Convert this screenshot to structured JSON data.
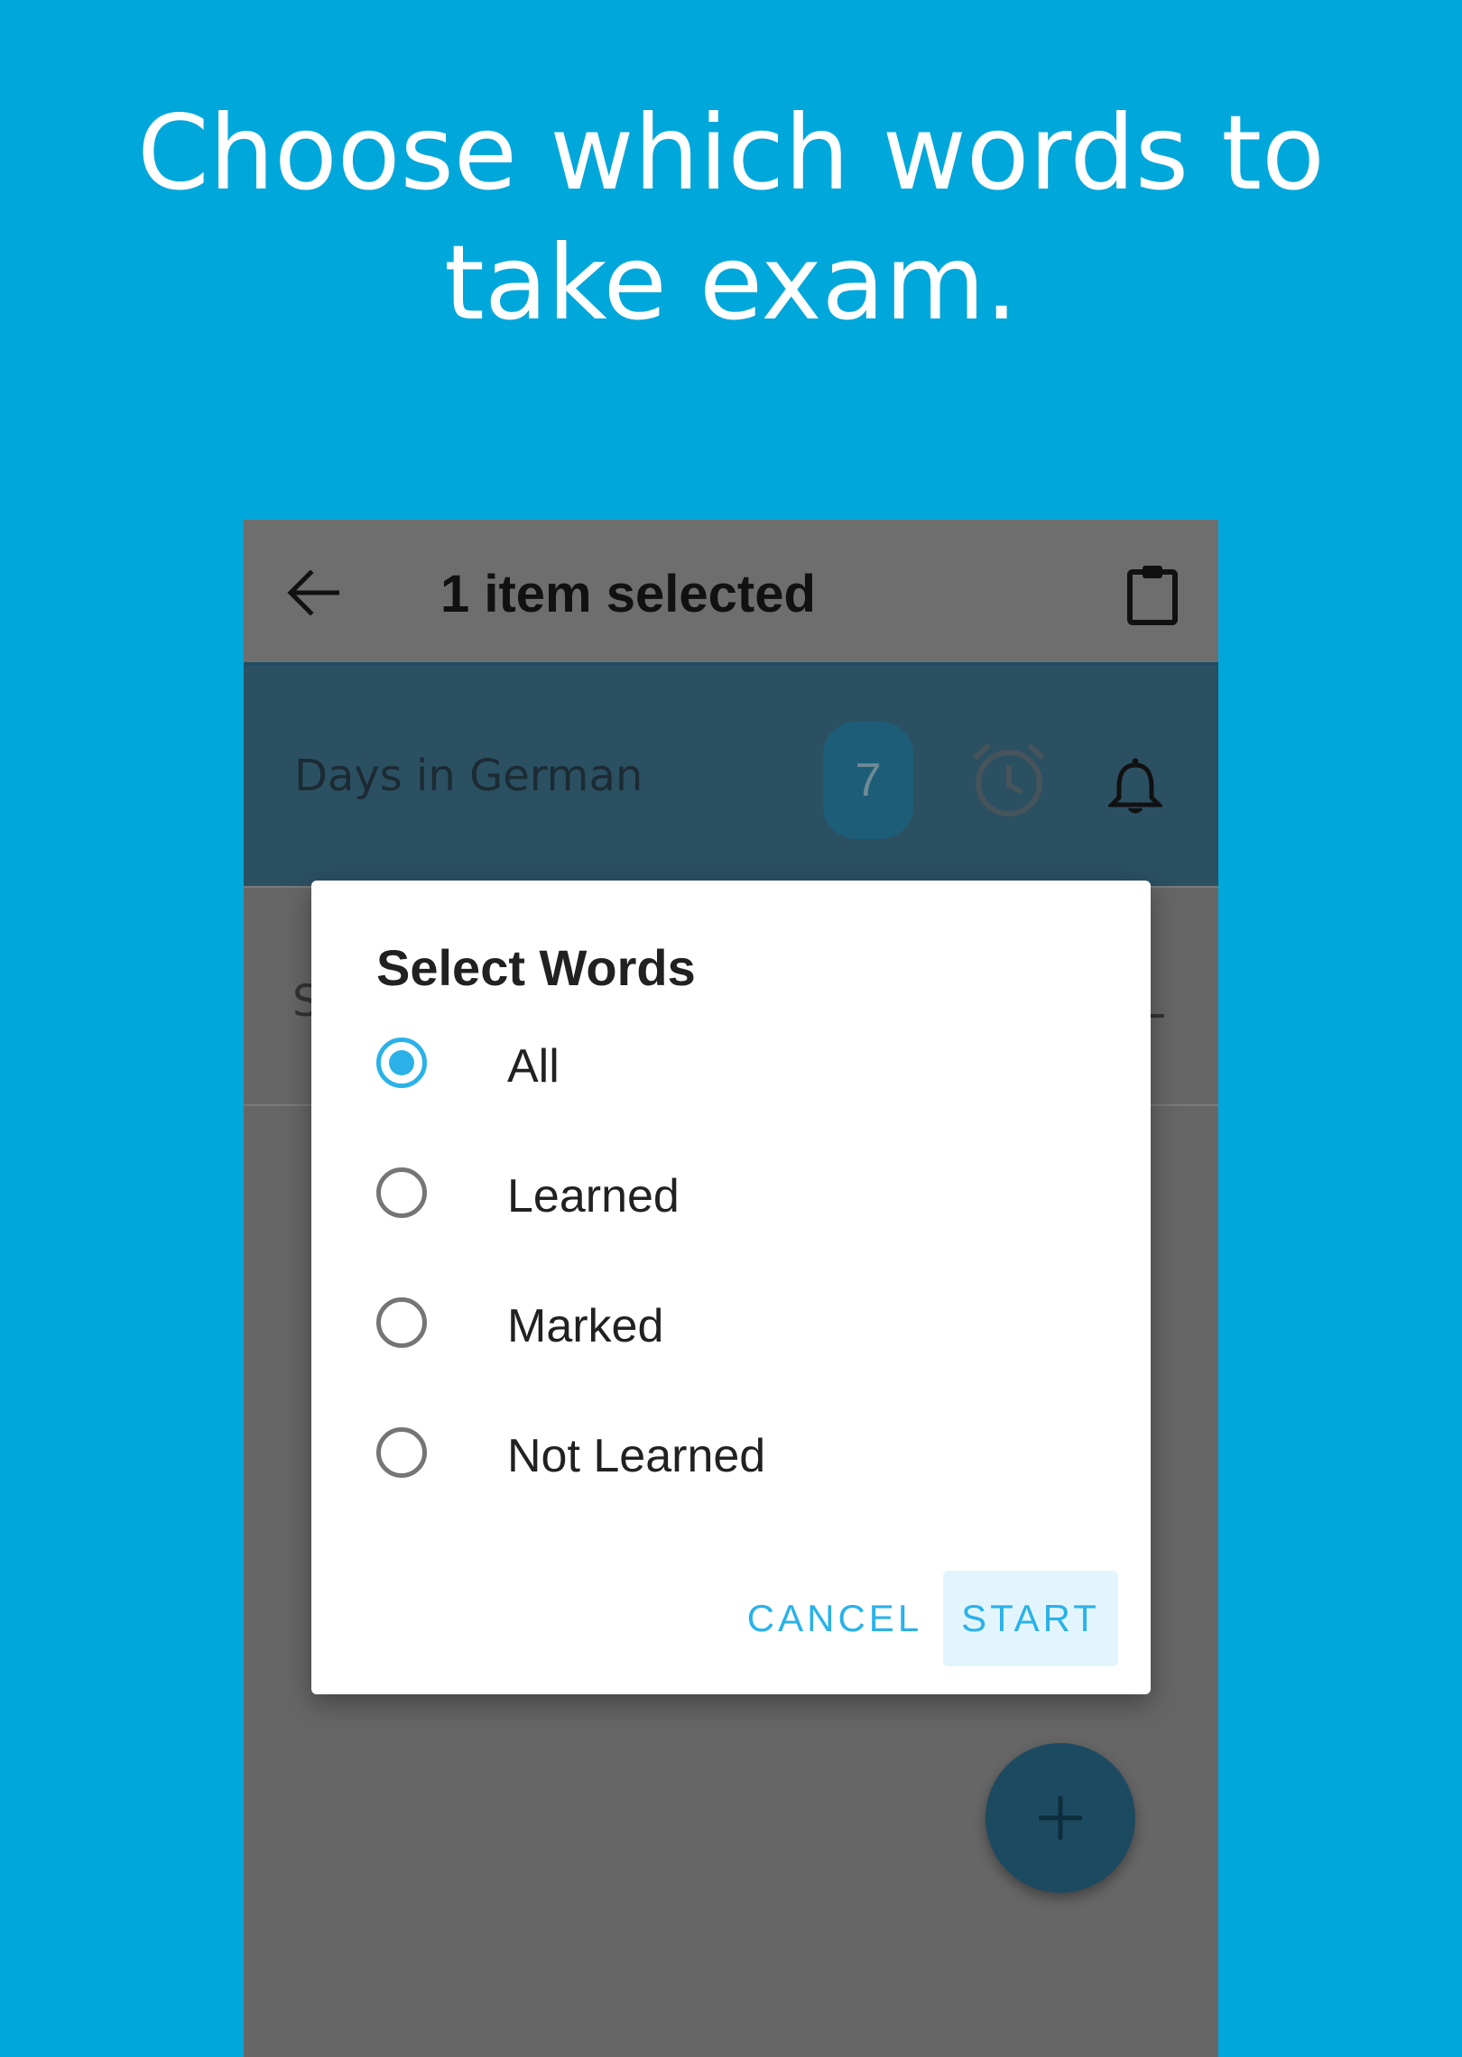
{
  "headline": {
    "line1": "Choose which words to",
    "line2": "take exam."
  },
  "appbar": {
    "title": "1 item selected",
    "back_icon": "arrow-back-icon",
    "clipboard_icon": "clipboard-icon"
  },
  "list": {
    "selected_row": {
      "title": "Days in German",
      "count": "7",
      "alarm_icon": "alarm-clock-icon",
      "bell_icon": "bell-icon"
    },
    "second_row": {
      "initial": "S"
    }
  },
  "dialog": {
    "title": "Select Words",
    "options": [
      {
        "label": "All",
        "selected": true
      },
      {
        "label": "Learned",
        "selected": false
      },
      {
        "label": "Marked",
        "selected": false
      },
      {
        "label": "Not Learned",
        "selected": false
      }
    ],
    "cancel_label": "CANCEL",
    "start_label": "START"
  },
  "colors": {
    "background": "#00a7da",
    "accent": "#2ab2e8",
    "selected_row": "#2b5062",
    "fab": "#1c4a61"
  }
}
